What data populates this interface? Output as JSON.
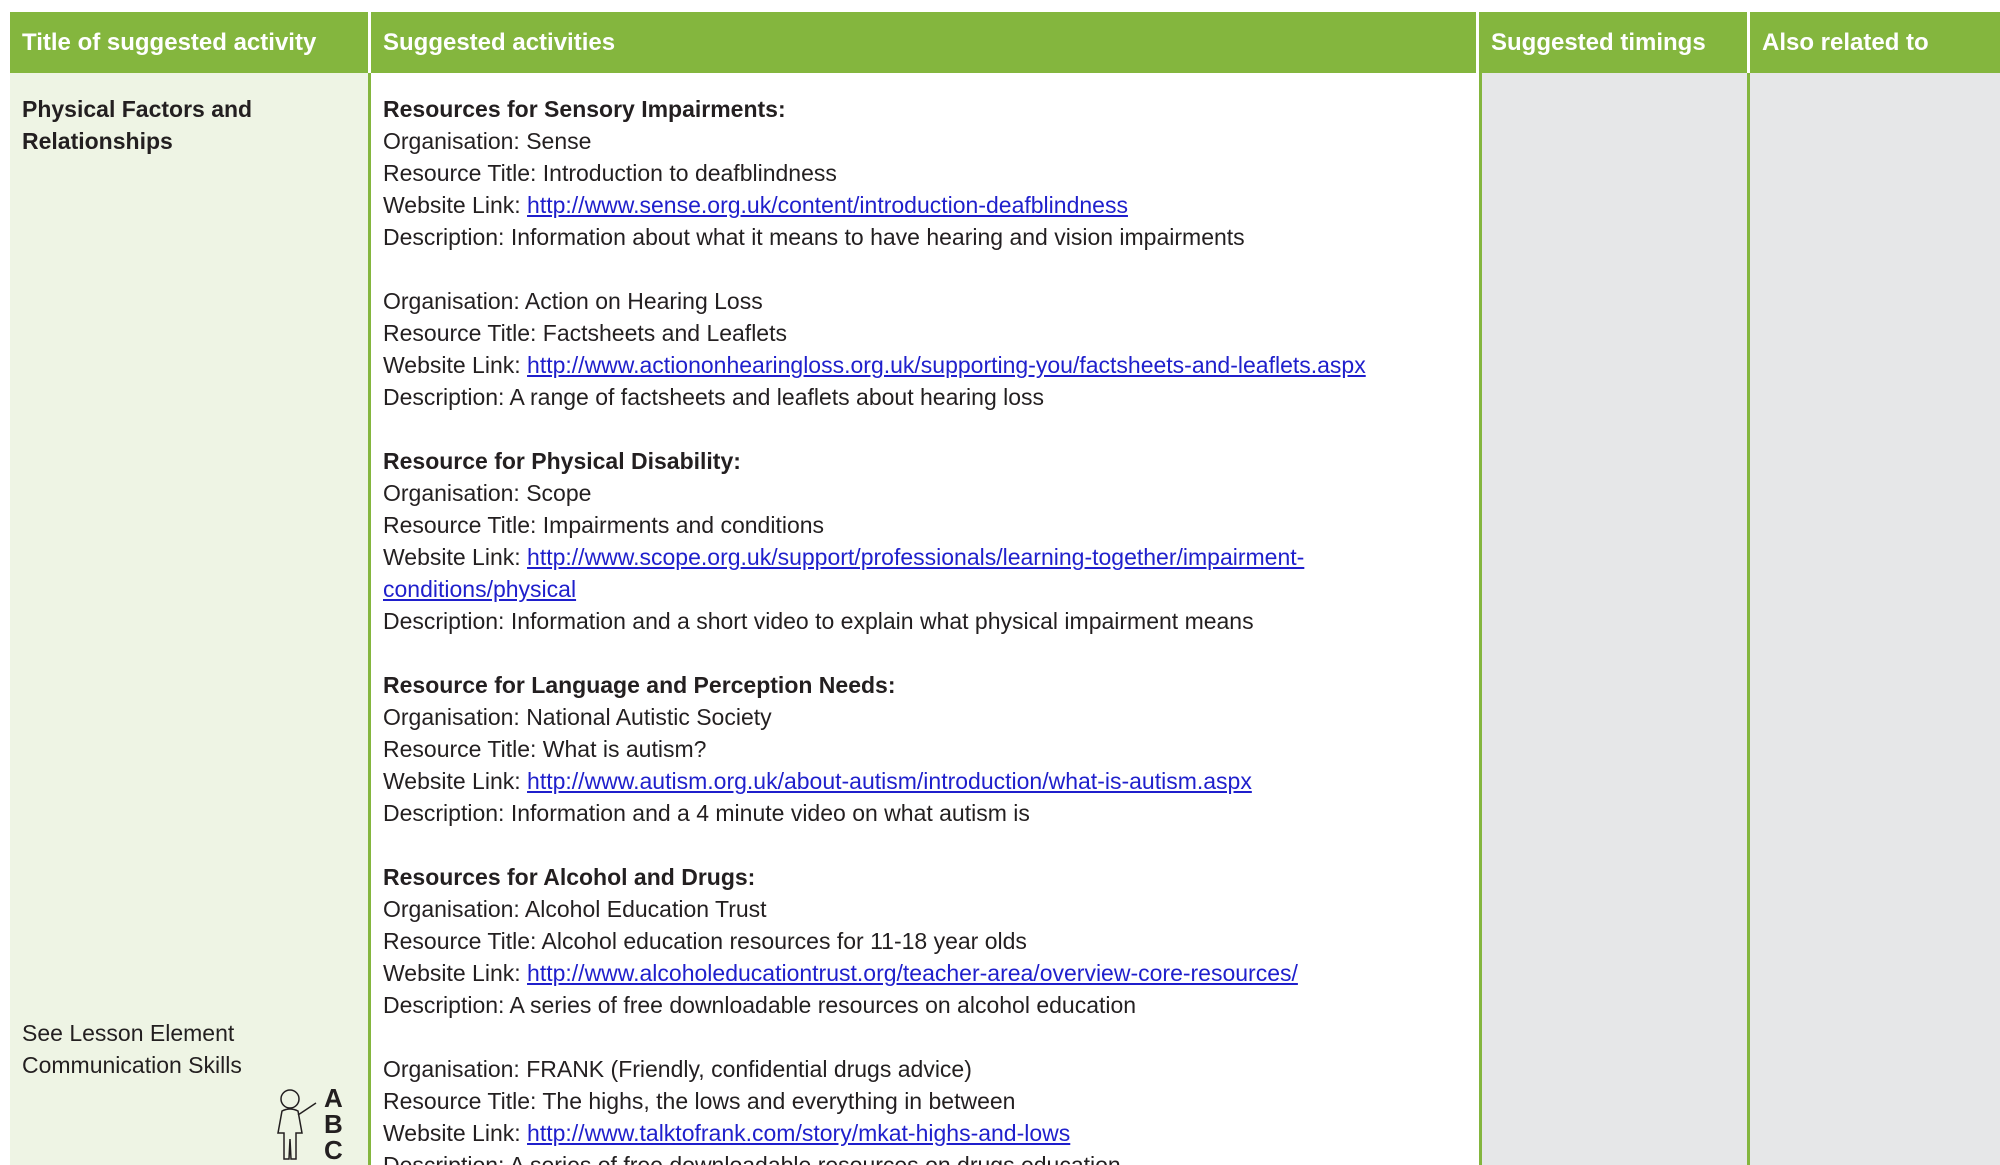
{
  "headers": {
    "title": "Title of suggested activity",
    "activities": "Suggested activities",
    "timings": "Suggested timings",
    "related": "Also related to"
  },
  "title_cell": {
    "heading_line1": "Physical Factors and",
    "heading_line2": "Relationships",
    "see_line1": "See Lesson Element",
    "see_line2": "Communication Skills",
    "abc_icon_letters": "ABC"
  },
  "activities": {
    "sec1_heading": "Resources for Sensory Impairments:",
    "r1_org": "Organisation: Sense",
    "r1_title": "Resource Title: Introduction to deafblindness",
    "r1_link_label": "Website Link: ",
    "r1_link": "http://www.sense.org.uk/content/introduction-deafblindness",
    "r1_desc": "Description: Information about what it means to have hearing and vision impairments",
    "r2_org": "Organisation: Action on Hearing Loss",
    "r2_title": "Resource Title: Factsheets and Leaflets",
    "r2_link_label": "Website Link: ",
    "r2_link": "http://www.actiononhearingloss.org.uk/supporting-you/factsheets-and-leaflets.aspx",
    "r2_desc": "Description: A range of factsheets and leaflets about hearing loss",
    "sec2_heading": "Resource for Physical Disability:",
    "r3_org": "Organisation: Scope",
    "r3_title": "Resource Title: Impairments and conditions",
    "r3_link_label": "Website Link: ",
    "r3_link_part1": "http://www.scope.org.uk/support/professionals/learning-together/impairment-",
    "r3_link_part2": "conditions/physical",
    "r3_desc": "Description: Information and a short video to explain what physical impairment means",
    "sec3_heading": "Resource for Language and Perception Needs:",
    "r4_org": "Organisation: National Autistic Society",
    "r4_title": "Resource Title: What is autism?",
    "r4_link_label": "Website Link: ",
    "r4_link": "http://www.autism.org.uk/about-autism/introduction/what-is-autism.aspx",
    "r4_desc": "Description: Information and a 4 minute video on what autism is",
    "sec4_heading": "Resources for Alcohol and Drugs:",
    "r5_org": "Organisation: Alcohol Education Trust",
    "r5_title": "Resource Title: Alcohol education resources for 11-18 year olds",
    "r5_link_label": "Website Link: ",
    "r5_link": "http://www.alcoholeducationtrust.org/teacher-area/overview-core-resources/",
    "r5_desc": "Description: A series of free downloadable resources on alcohol education",
    "r6_org": "Organisation: FRANK (Friendly, confidential drugs advice)",
    "r6_title": "Resource Title: The highs, the lows and everything in between",
    "r6_link_label": "Website Link: ",
    "r6_link": "http://www.talktofrank.com/story/mkat-highs-and-lows",
    "r6_desc": "Description: A series of free downloadable resources on drugs education"
  },
  "colors": {
    "header_green": "#84b63e",
    "title_cell_bg": "#eef4e4",
    "grey_cell_bg": "#e6e7e8",
    "link_blue": "#1f1fcc"
  }
}
